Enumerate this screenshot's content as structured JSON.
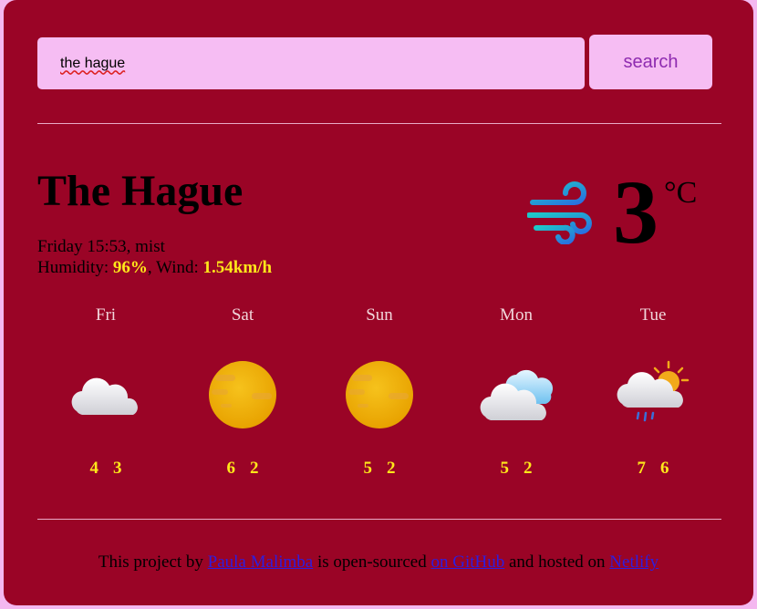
{
  "search": {
    "input_value": "the hague",
    "button_label": "search"
  },
  "current": {
    "city": "The Hague",
    "day_time": "Friday 15:53",
    "description": "mist",
    "humidity_label": "Humidity:",
    "humidity_value": "96%",
    "wind_label": "Wind:",
    "wind_value": "1.54km/h",
    "temperature": "3",
    "unit": "°C",
    "icon": "wind-icon"
  },
  "forecast": [
    {
      "day": "Fri",
      "max": "4",
      "min": "3",
      "icon": "cloud-icon"
    },
    {
      "day": "Sat",
      "max": "6",
      "min": "2",
      "icon": "sun-icon"
    },
    {
      "day": "Sun",
      "max": "5",
      "min": "2",
      "icon": "sun-icon"
    },
    {
      "day": "Mon",
      "max": "5",
      "min": "2",
      "icon": "cloudy-icon"
    },
    {
      "day": "Tue",
      "max": "7",
      "min": "6",
      "icon": "sun-cloud-rain-icon"
    }
  ],
  "footer": {
    "text1": "This project by",
    "author_link": "Paula Malimba",
    "text2": "is open-sourced",
    "github_link": "on GitHub",
    "text3": "and hosted on",
    "netlify_link": "Netlify"
  }
}
